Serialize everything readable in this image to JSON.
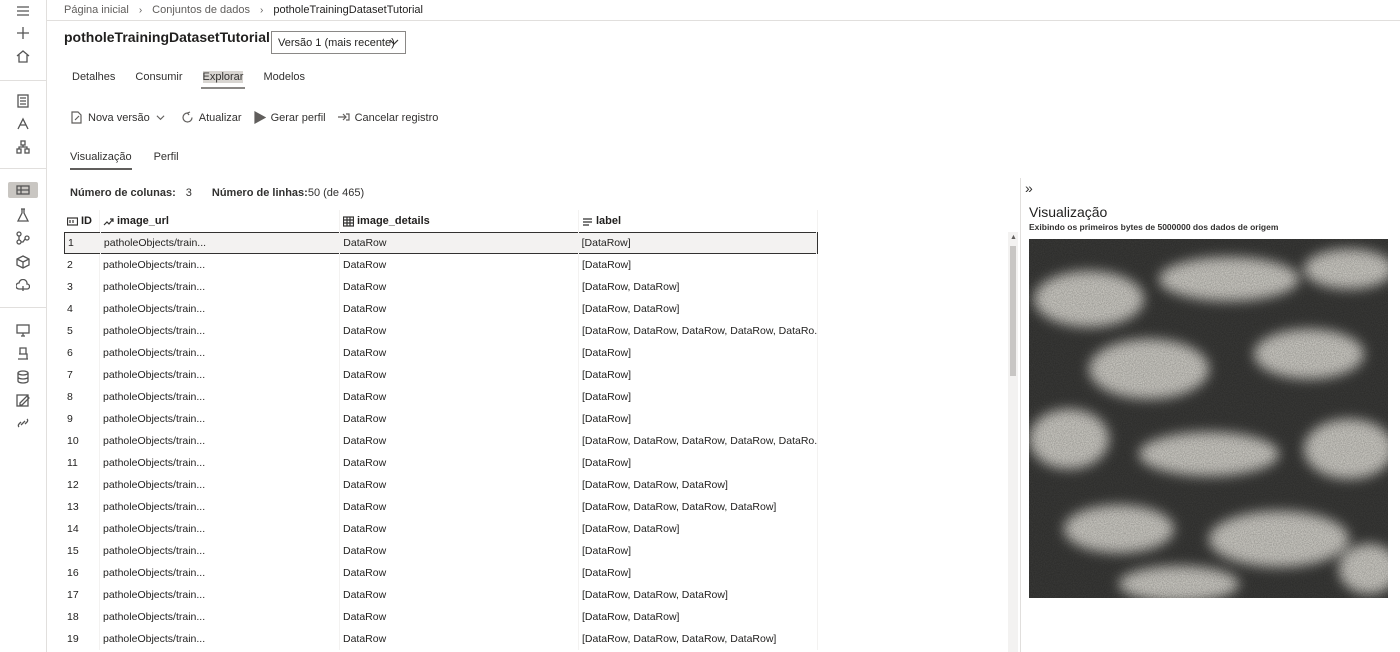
{
  "breadcrumb": [
    "Página inicial",
    "Conjuntos de dados",
    "potholeTrainingDatasetTutorial"
  ],
  "title": "potholeTrainingDatasetTutorial",
  "version_select": "Versão 1 (mais recente)",
  "tabs": [
    "Detalhes",
    "Consumir",
    "Explorar",
    "Modelos"
  ],
  "active_tab": "Explorar",
  "toolbar": {
    "new_version": "Nova versão",
    "refresh": "Atualizar",
    "profile": "Gerar perfil",
    "unregister": "Cancelar registro"
  },
  "subtabs": [
    "Visualização",
    "Perfil"
  ],
  "counts": {
    "columns_label": "Número de colunas:",
    "columns_value": "3",
    "rows_label": "Número de linhas:",
    "rows_value": "50 (de 465)"
  },
  "table": {
    "headers": [
      "ID",
      "image_url",
      "image_details",
      "label"
    ],
    "rows": [
      [
        "1",
        "patholeObjects/train...",
        "DataRow",
        "[DataRow]"
      ],
      [
        "2",
        "patholeObjects/train...",
        "DataRow",
        "[DataRow]"
      ],
      [
        "3",
        "patholeObjects/train...",
        "DataRow",
        "[DataRow, DataRow]"
      ],
      [
        "4",
        "patholeObjects/train...",
        "DataRow",
        "[DataRow, DataRow]"
      ],
      [
        "5",
        "patholeObjects/train...",
        "DataRow",
        "[DataRow, DataRow, DataRow, DataRow, DataRo..."
      ],
      [
        "6",
        "patholeObjects/train...",
        "DataRow",
        "[DataRow]"
      ],
      [
        "7",
        "patholeObjects/train...",
        "DataRow",
        "[DataRow]"
      ],
      [
        "8",
        "patholeObjects/train...",
        "DataRow",
        "[DataRow]"
      ],
      [
        "9",
        "patholeObjects/train...",
        "DataRow",
        "[DataRow]"
      ],
      [
        "10",
        "patholeObjects/train...",
        "DataRow",
        "[DataRow, DataRow, DataRow, DataRow, DataRo..."
      ],
      [
        "11",
        "patholeObjects/train...",
        "DataRow",
        "[DataRow]"
      ],
      [
        "12",
        "patholeObjects/train...",
        "DataRow",
        "[DataRow, DataRow, DataRow]"
      ],
      [
        "13",
        "patholeObjects/train...",
        "DataRow",
        "[DataRow, DataRow, DataRow, DataRow]"
      ],
      [
        "14",
        "patholeObjects/train...",
        "DataRow",
        "[DataRow, DataRow]"
      ],
      [
        "15",
        "patholeObjects/train...",
        "DataRow",
        "[DataRow]"
      ],
      [
        "16",
        "patholeObjects/train...",
        "DataRow",
        "[DataRow]"
      ],
      [
        "17",
        "patholeObjects/train...",
        "DataRow",
        "[DataRow, DataRow, DataRow]"
      ],
      [
        "18",
        "patholeObjects/train...",
        "DataRow",
        "[DataRow, DataRow]"
      ],
      [
        "19",
        "patholeObjects/train...",
        "DataRow",
        "[DataRow, DataRow, DataRow, DataRow]"
      ]
    ]
  },
  "preview": {
    "title": "Visualização",
    "subtitle": "Exibindo os primeiros bytes de 5000000 dos dados de origem"
  }
}
